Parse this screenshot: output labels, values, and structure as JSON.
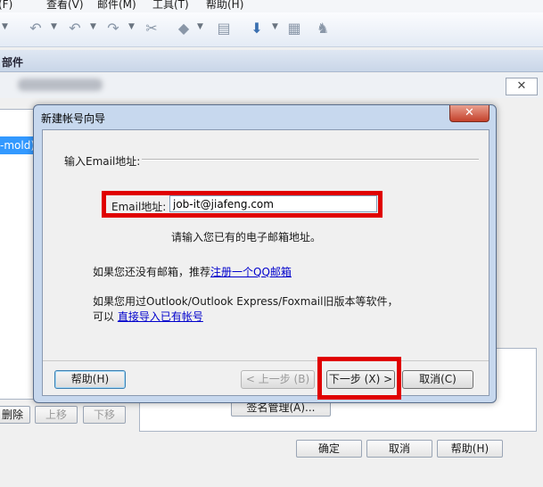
{
  "menubar": {
    "items": [
      "文件(F)",
      "查看(V)",
      "邮件(M)",
      "工具(T)",
      "帮助(H)"
    ]
  },
  "toolbar": {
    "icons": [
      "reply-icon",
      "reply-all-icon",
      "forward-icon",
      "delete-icon",
      "tag-icon",
      "print-icon",
      "download-icon",
      "address-book-icon",
      "spam-icon"
    ]
  },
  "panel": {
    "title": "部件",
    "close_glyph": "✕"
  },
  "left_list": {
    "selected_item": "-mold)"
  },
  "bg_buttons": {
    "delete": "删除",
    "move_up": "上移",
    "move_down": "下移",
    "signature": "签名管理(A)...",
    "ok": "确定",
    "cancel": "取消",
    "help": "帮助(H)"
  },
  "dialog": {
    "title": "新建帐号向导",
    "close_glyph": "✕",
    "section_label": "输入Email地址:",
    "email": {
      "label": "Email地址:",
      "value": "job-it@jiafeng.com",
      "placeholder": ""
    },
    "hint": "请输入您已有的电子邮箱地址。",
    "no_email_prefix": "如果您还没有邮箱，推荐",
    "no_email_link": "注册一个QQ邮箱",
    "import_line1": "如果您用过Outlook/Outlook Express/Foxmail旧版本等软件，",
    "import_prefix": "可以",
    "import_link": "直接导入已有帐号",
    "buttons": {
      "help": "帮助(H)",
      "prev": "< 上一步 (B)",
      "next": "下一步 (X) >",
      "cancel": "取消(C)"
    }
  },
  "colors": {
    "highlight": "#e00000",
    "link": "#0000cc",
    "selection": "#3399ff",
    "close_button": "#c4412b"
  }
}
